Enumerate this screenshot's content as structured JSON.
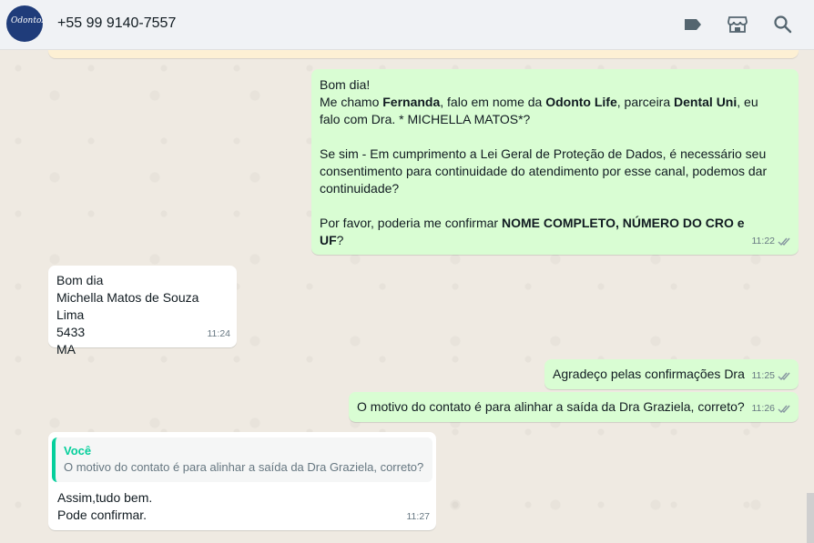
{
  "header": {
    "avatar_logo_text": "OdontoLife",
    "contact": "+55 99 9140-7557",
    "icons": [
      "label-icon",
      "shop-icon",
      "search-icon"
    ]
  },
  "messages": [
    {
      "direction": "out",
      "paragraphs": [
        [
          "Bom dia!"
        ],
        [
          "Me chamo ",
          "Fernanda",
          ", falo em nome da ",
          "Odonto Life",
          ", parceira ",
          "Dental Uni",
          ", eu falo com Dra. * MICHELLA MATOS*?"
        ],
        [
          ""
        ],
        [
          "Se sim - Em cumprimento a Lei Geral de Proteção de Dados, é necessário seu consentimento para continuidade do atendimento por esse canal, podemos dar continuidade?"
        ],
        [
          ""
        ],
        [
          "Por favor, poderia me confirmar ",
          "NOME COMPLETO, NÚMERO DO CRO e UF",
          "?"
        ]
      ],
      "time": "11:22"
    },
    {
      "direction": "in",
      "lines": [
        "Bom dia",
        "Michella Matos de Souza Lima",
        "5433",
        "MA"
      ],
      "time": "11:24"
    },
    {
      "direction": "out",
      "text": "Agradeço pelas confirmações Dra",
      "time": "11:25"
    },
    {
      "direction": "out",
      "text": "O motivo do contato é para alinhar a saída da Dra Graziela, correto?",
      "time": "11:26"
    },
    {
      "direction": "in",
      "quote": {
        "author": "Você",
        "text": "O motivo do contato é para alinhar a saída da Dra Graziela, correto?"
      },
      "lines": [
        "Assim,tudo bem.",
        "Pode confirmar."
      ],
      "time": "11:27"
    }
  ],
  "colors": {
    "outgoing": "#d9fdd3",
    "incoming": "#ffffff",
    "tick": "#8696a0",
    "quote_accent": "#06cf9c"
  }
}
